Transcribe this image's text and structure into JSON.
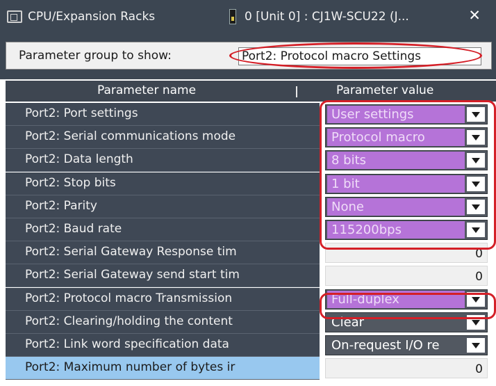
{
  "tabs": [
    {
      "label": "CPU/Expansion Racks",
      "icon": "rack-icon"
    },
    {
      "label": "0 [Unit 0] : CJ1W-SCU22 (J...",
      "icon": "unit-module-icon",
      "closable": true
    }
  ],
  "group_selector": {
    "label": "Parameter group to show:",
    "value": "Port2: Protocol macro Settings"
  },
  "table": {
    "headers": {
      "name": "Parameter name",
      "value": "Parameter value"
    },
    "rows": [
      {
        "name": "Port2: Port settings",
        "value": "User settings",
        "control": "dropdown",
        "style": "highlighted"
      },
      {
        "name": "Port2: Serial communications mode",
        "value": "Protocol macro",
        "control": "dropdown",
        "style": "highlighted"
      },
      {
        "name": "Port2: Data length",
        "value": "8 bits",
        "control": "dropdown",
        "style": "highlighted"
      },
      {
        "name": "Port2: Stop bits",
        "value": "1 bit",
        "control": "dropdown",
        "style": "highlighted"
      },
      {
        "name": "Port2: Parity",
        "value": "None",
        "control": "dropdown",
        "style": "highlighted"
      },
      {
        "name": "Port2: Baud rate",
        "value": "115200bps",
        "control": "dropdown",
        "style": "highlighted"
      },
      {
        "name": "Port2: Serial Gateway Response tim",
        "value": "0",
        "control": "number"
      },
      {
        "name": "Port2: Serial Gateway send start tim",
        "value": "0",
        "control": "number"
      },
      {
        "name": "Port2: Protocol macro Transmission",
        "value": "Full-duplex",
        "control": "dropdown",
        "style": "highlighted"
      },
      {
        "name": "Port2: Clearing/holding the content",
        "value": "Clear",
        "control": "dropdown",
        "style": "plain"
      },
      {
        "name": "Port2: Link word specification data",
        "value": "On-request I/O re",
        "control": "dropdown",
        "style": "plain"
      },
      {
        "name": "Port2: Maximum number of bytes ir",
        "value": "0",
        "control": "number",
        "selected": true
      }
    ]
  },
  "colors": {
    "panel_bg": "#3c4652",
    "highlight_value": "#b573d8",
    "annotation_red": "#d41f27",
    "selected_row": "#98c8ef"
  }
}
